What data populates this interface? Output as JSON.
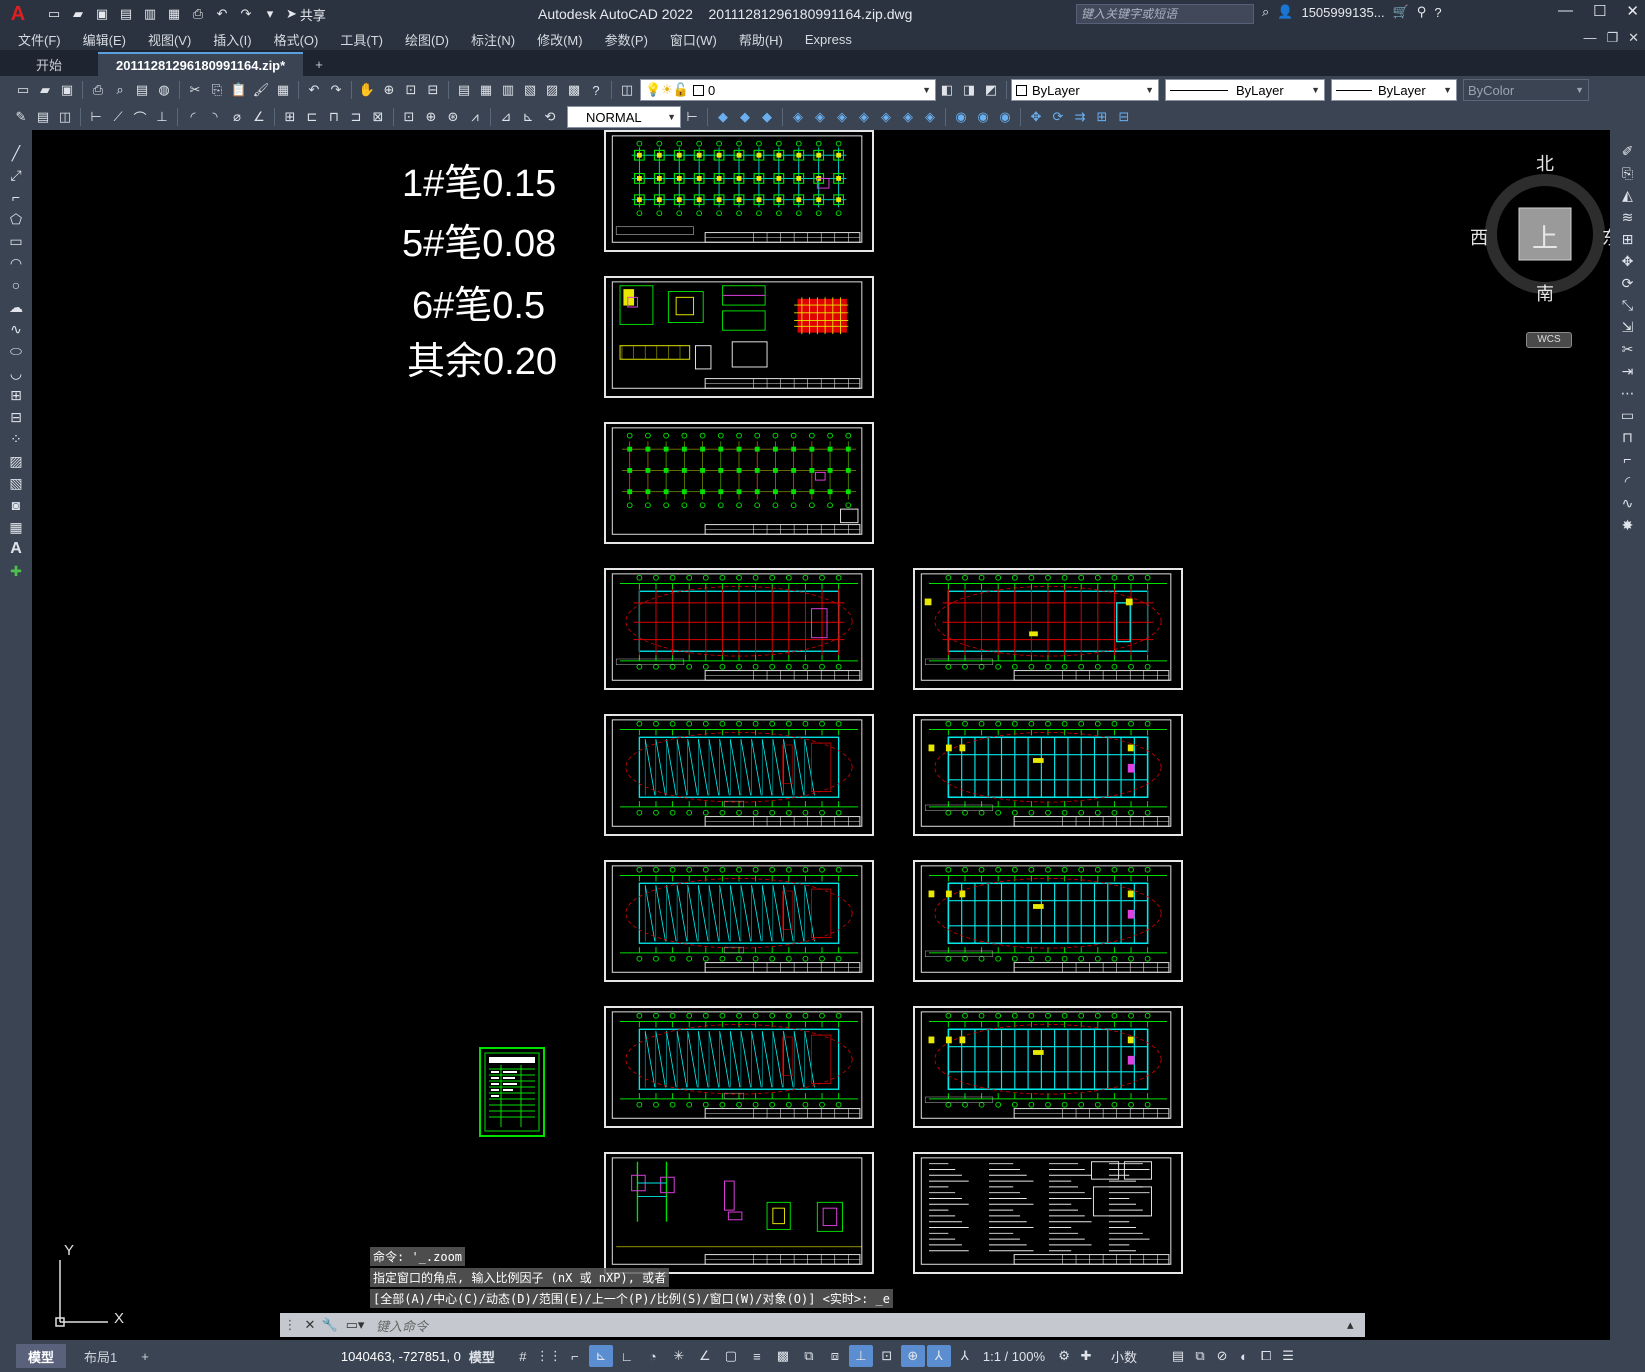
{
  "title_bar": {
    "app_title": "Autodesk AutoCAD 2022",
    "file_name": "20111281296180991164.zip.dwg",
    "share_label": "共享",
    "search_placeholder": "键入关键字或短语",
    "user_name": "1505999135..."
  },
  "menu": [
    "文件(F)",
    "编辑(E)",
    "视图(V)",
    "插入(I)",
    "格式(O)",
    "工具(T)",
    "绘图(D)",
    "标注(N)",
    "修改(M)",
    "参数(P)",
    "窗口(W)",
    "帮助(H)",
    "Express"
  ],
  "tabs": {
    "start": "开始",
    "active": "20111281296180991164.zip*",
    "add": "+"
  },
  "layer_combo": "0",
  "color_combo": "ByLayer",
  "linetype_combo": "ByLayer",
  "lineweight_combo": "ByLayer",
  "plotstyle_combo": "ByColor",
  "dimstyle_combo": "NORMAL",
  "pen_notes": [
    "1#笔0.15",
    "5#笔0.08",
    "6#笔0.5",
    "其余0.20"
  ],
  "viewcube": {
    "north": "北",
    "south": "南",
    "east": "东",
    "west": "西",
    "top": "上",
    "wcs": "WCS"
  },
  "ucs": {
    "y": "Y",
    "x": "X"
  },
  "command_history": [
    "命令: '_.zoom",
    "指定窗口的角点, 输入比例因子 (nX 或 nXP), 或者",
    "[全部(A)/中心(C)/动态(D)/范围(E)/上一个(P)/比例(S)/窗口(W)/对象(O)] <实时>: _e"
  ],
  "command_placeholder": "键入命令",
  "status": {
    "model_tab": "模型",
    "layout_tab": "布局1",
    "add": "+",
    "coordinates": "1040463, -727851, 0",
    "space": "模型",
    "scale": "1:1 / 100%",
    "units": "小数"
  },
  "colors": {
    "grid_green": "#00e000",
    "axis_red": "#e00000",
    "beam_cyan": "#00e8e8",
    "frame_white": "#e6e6e6"
  }
}
